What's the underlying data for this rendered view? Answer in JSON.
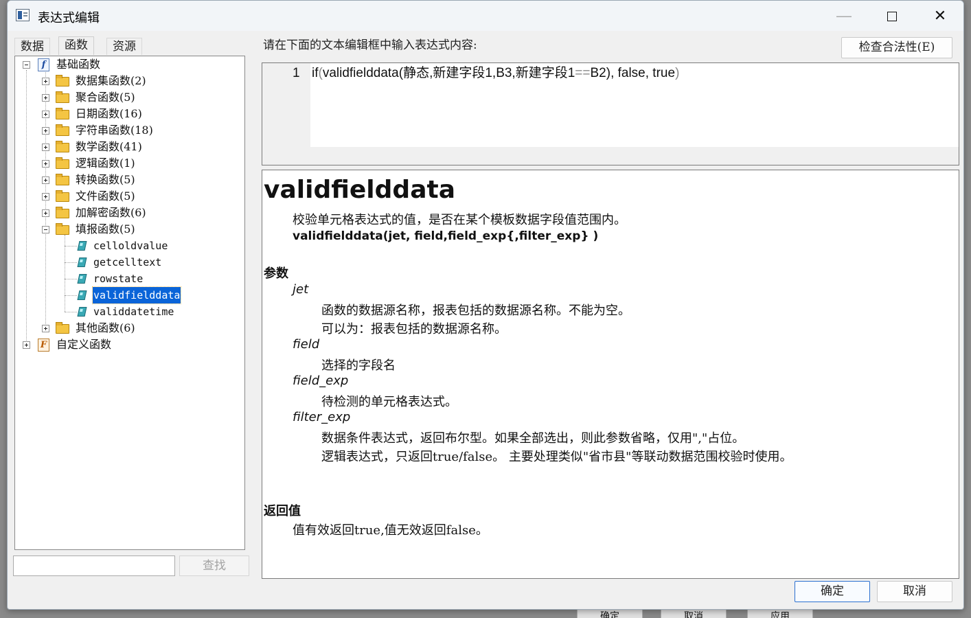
{
  "window": {
    "title": "表达式编辑"
  },
  "background_dialog": {
    "buttons": [
      "确定",
      "取消",
      "应用"
    ]
  },
  "tabs": [
    {
      "label": "数据"
    },
    {
      "label": "函数"
    },
    {
      "label": "资源"
    }
  ],
  "active_tab": "函数",
  "tree": {
    "root": {
      "label": "基础函数",
      "icon": "function-icon"
    },
    "folders": [
      {
        "label": "数据集函数(2)"
      },
      {
        "label": "聚合函数(5)"
      },
      {
        "label": "日期函数(16)"
      },
      {
        "label": "字符串函数(18)"
      },
      {
        "label": "数学函数(41)"
      },
      {
        "label": "逻辑函数(1)"
      },
      {
        "label": "转换函数(5)"
      },
      {
        "label": "文件函数(5)"
      },
      {
        "label": "加解密函数(6)"
      },
      {
        "label": "填报函数(5)"
      }
    ],
    "leaves": [
      {
        "label": "celloldvalue"
      },
      {
        "label": "getcelltext"
      },
      {
        "label": "rowstate"
      },
      {
        "label": "validfielddata"
      },
      {
        "label": "validdatetime"
      }
    ],
    "selected_leaf": "validfielddata",
    "other_folder": {
      "label": "其他函数(6)"
    },
    "custom_root": {
      "label": "自定义函数",
      "icon": "custom-function-icon"
    }
  },
  "search": {
    "value": "",
    "button_label": "查找"
  },
  "prompt": "请在下面的文本编辑框中输入表达式内容:",
  "check_button": "检查合法性(E)",
  "editor": {
    "line_number": "1",
    "code": {
      "prefix": "if",
      "open": "(",
      "body": "validfielddata(静态,新建字段1,B3,新建字段1",
      "op": "==",
      "body2": "B2",
      "close_inner": ")",
      "tail": ", false, true",
      "close": ")"
    }
  },
  "help": {
    "func_name": "validfielddata",
    "description": "校验单元格表达式的值，是否在某个模板数据字段值范围内。",
    "signature": "validfielddata(jet, field,field_exp{,filter_exp} )",
    "params_title": "参数",
    "params": [
      {
        "name": "jet",
        "desc": [
          "函数的数据源名称，报表包括的数据源名称。不能为空。",
          "可以为：报表包括的数据源名称。"
        ]
      },
      {
        "name": "field",
        "desc": [
          "选择的字段名"
        ]
      },
      {
        "name": "field_exp",
        "desc": [
          "待检测的单元格表达式。"
        ]
      },
      {
        "name": "filter_exp",
        "desc": [
          "数据条件表达式，返回布尔型。如果全部选出，则此参数省略，仅用\",\"占位。",
          "逻辑表达式，只返回true/false。 主要处理类似\"省市县\"等联动数据范围校验时使用。"
        ]
      }
    ],
    "return_title": "返回值",
    "return_desc": "值有效返回true,值无效返回false。"
  },
  "ok_button": "确定",
  "cancel_button": "取消"
}
